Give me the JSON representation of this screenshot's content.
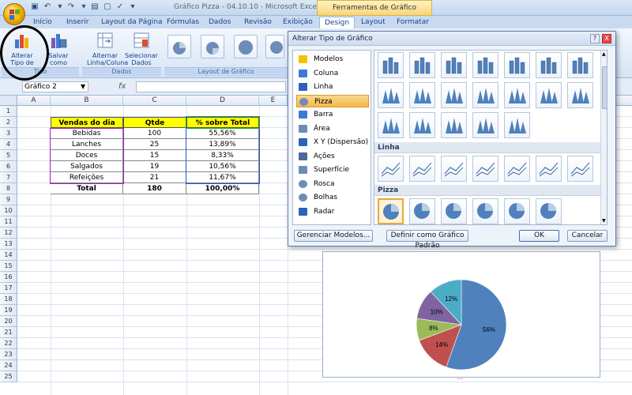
{
  "window": {
    "title": "Gráfico Pizza - 04.10.10 - Microsoft Excel",
    "context_tab_group": "Ferramentas de Gráfico"
  },
  "tabs": [
    "Início",
    "Inserir",
    "Layout da Página",
    "Fórmulas",
    "Dados",
    "Revisão",
    "Exibição",
    "Design",
    "Layout",
    "Formatar"
  ],
  "active_tab": "Design",
  "ribbon": {
    "change_type_label": "Alterar Tipo de Gráfico",
    "save_model_label": "Salvar como Modelo",
    "switch_row_col_label": "Alternar Linha/Coluna",
    "select_data_label": "Selecionar Dados",
    "group_type": "Tipo",
    "group_data": "Dados",
    "group_layouts": "Layout de Gráfico"
  },
  "formula_bar": {
    "name_box": "Gráfico 2",
    "fx": "fx"
  },
  "columns": [
    "A",
    "B",
    "C",
    "D",
    "E"
  ],
  "rows": [
    "1",
    "2",
    "3",
    "4",
    "5",
    "6",
    "7",
    "8",
    "9",
    "10",
    "11",
    "12",
    "13",
    "14",
    "15",
    "16",
    "17",
    "18",
    "19",
    "20",
    "21",
    "22",
    "23",
    "24",
    "25"
  ],
  "table": {
    "headers": [
      "Vendas do dia",
      "Qtde",
      "% sobre Total"
    ],
    "rows": [
      [
        "Bebidas",
        "100",
        "55,56%"
      ],
      [
        "Lanches",
        "25",
        "13,89%"
      ],
      [
        "Doces",
        "15",
        "8,33%"
      ],
      [
        "Salgados",
        "19",
        "10,56%"
      ],
      [
        "Refeições",
        "21",
        "11,67%"
      ]
    ],
    "total": [
      "Total",
      "180",
      "100,00%"
    ]
  },
  "dialog": {
    "title": "Alterar Tipo de Gráfico",
    "categories": [
      "Modelos",
      "Coluna",
      "Linha",
      "Pizza",
      "Barra",
      "Área",
      "X Y (Dispersão)",
      "Ações",
      "Superfície",
      "Rosca",
      "Bolhas",
      "Radar"
    ],
    "selected_category": "Pizza",
    "section_line": "Linha",
    "section_pie": "Pizza",
    "manage_button": "Gerenciar Modelos...",
    "default_button": "Definir como Gráfico Padrão",
    "ok_button": "OK",
    "cancel_button": "Cancelar",
    "help_label": "?",
    "close_label": "X"
  },
  "chart_data": {
    "type": "pie",
    "categories": [
      "Bebidas",
      "Lanches",
      "Doces",
      "Salgados",
      "Refeições"
    ],
    "values": [
      56,
      14,
      8,
      11,
      12
    ],
    "data_labels": [
      "56%",
      "14%",
      "8%",
      "10%",
      "12%"
    ],
    "colors": [
      "#4f81bd",
      "#c0504d",
      "#9bbb59",
      "#8064a2",
      "#4bacc6"
    ]
  }
}
